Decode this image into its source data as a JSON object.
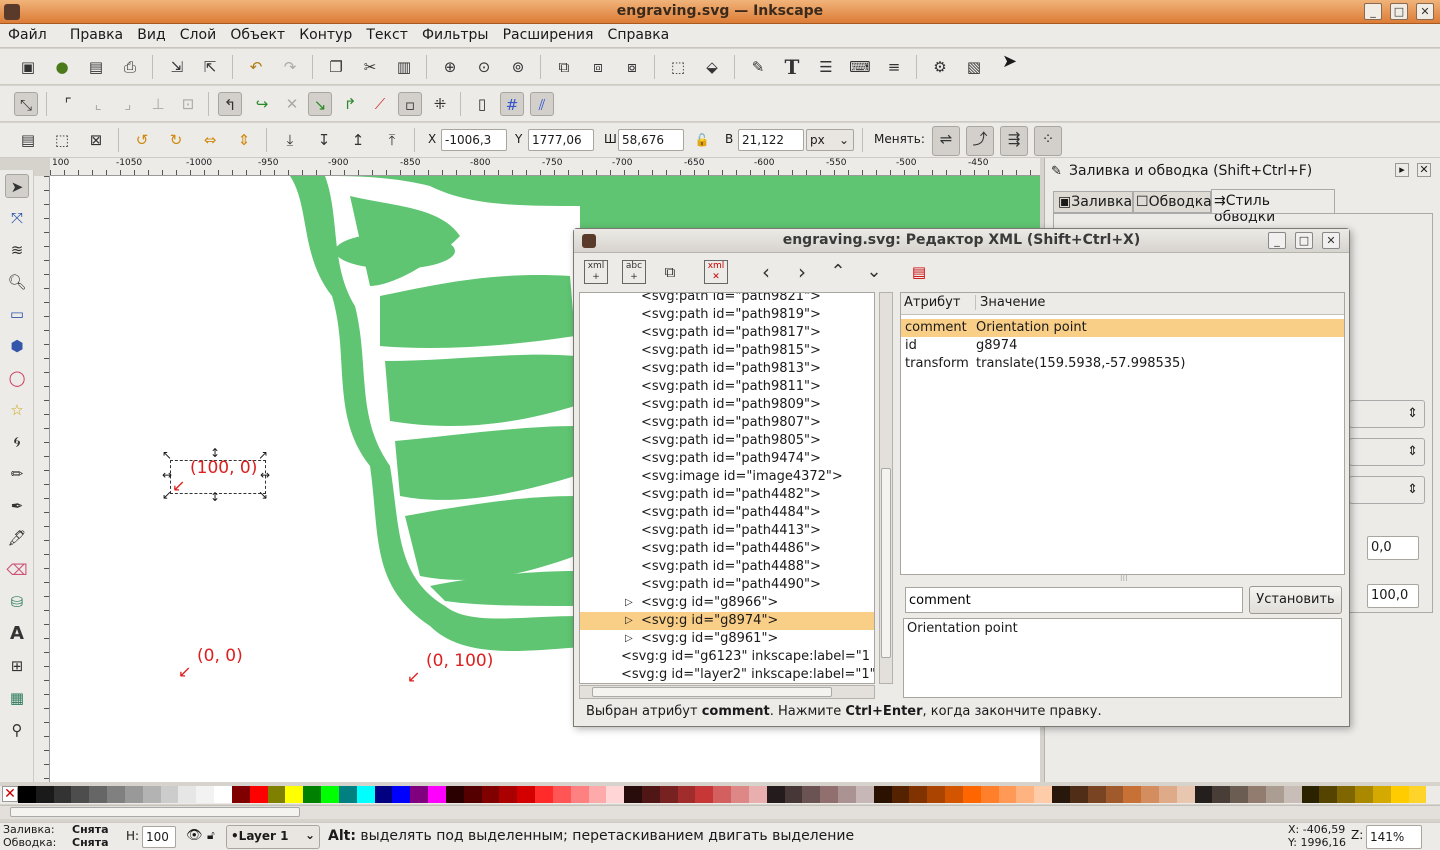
{
  "window": {
    "title": "engraving.svg — Inkscape"
  },
  "menu": [
    "Файл",
    "Правка",
    "Вид",
    "Слой",
    "Объект",
    "Контур",
    "Текст",
    "Фильтры",
    "Расширения",
    "Справка"
  ],
  "toolctrl": {
    "x_label": "X",
    "x": "-1006,3⁠",
    "y_label": "Y",
    "y": "1777,06",
    "w_label": "Ш",
    "w": "58,676",
    "h_label": "В",
    "h": "21,122",
    "unit": "px",
    "change_label": "Менять:"
  },
  "hruler": [
    "100",
    "-1050",
    "-1000",
    "-950",
    "-900",
    "-850",
    "-800",
    "-750",
    "-700",
    "-650",
    "-600",
    "-550",
    "-500",
    "-450"
  ],
  "canvas": {
    "sel_label": "(100, 0)",
    "label_00": "(0, 0)",
    "label_0100": "(0, 100)"
  },
  "panel": {
    "title": "Заливка и обводка (Shift+Ctrl+F)",
    "tabs": [
      "Заливка",
      "Обводка",
      "Стиль обводки"
    ],
    "v1": "0,0",
    "v2": "100,0"
  },
  "xml": {
    "title": "engraving.svg: Редактор XML (Shift+Ctrl+X)",
    "nodes": [
      "<svg:path id=\"path9821\">",
      "<svg:path id=\"path9819\">",
      "<svg:path id=\"path9817\">",
      "<svg:path id=\"path9815\">",
      "<svg:path id=\"path9813\">",
      "<svg:path id=\"path9811\">",
      "<svg:path id=\"path9809\">",
      "<svg:path id=\"path9807\">",
      "<svg:path id=\"path9805\">",
      "<svg:path id=\"path9474\">",
      "<svg:image id=\"image4372\">",
      "<svg:path id=\"path4482\">",
      "<svg:path id=\"path4484\">",
      "<svg:path id=\"path4413\">",
      "<svg:path id=\"path4486\">",
      "<svg:path id=\"path4488\">",
      "<svg:path id=\"path4490\">",
      "<svg:g id=\"g8966\">",
      "<svg:g id=\"g8974\">",
      "<svg:g id=\"g8961\">",
      "<svg:g id=\"g6123\" inkscape:label=\"1 c",
      "<svg:g id=\"layer2\" inkscape:label=\"1\""
    ],
    "attr_header": "Атрибут",
    "value_header": "Значение",
    "attrs": [
      {
        "name": "comment",
        "value": "Orientation point"
      },
      {
        "name": "id",
        "value": "g8974"
      },
      {
        "name": "transform",
        "value": "translate(159.5938,-57.998535)"
      }
    ],
    "name_input": "comment",
    "set_button": "Установить",
    "value_text": "Orientation point",
    "status_a": "Выбран атрибут ",
    "status_b": "comment",
    "status_c": ". Нажмите ",
    "status_d": "Ctrl+Enter",
    "status_e": ", когда закончите правку."
  },
  "palette": [
    "#000000",
    "#1a1a1a",
    "#333333",
    "#4d4d4d",
    "#666666",
    "#808080",
    "#999999",
    "#b3b3b3",
    "#cccccc",
    "#e6e6e6",
    "#f2f2f2",
    "#ffffff",
    "#800000",
    "#ff0000",
    "#808000",
    "#ffff00",
    "#008000",
    "#00ff00",
    "#008080",
    "#00ffff",
    "#000080",
    "#0000ff",
    "#800080",
    "#ff00ff",
    "#2b0000",
    "#550000",
    "#800000",
    "#aa0000",
    "#d40000",
    "#ff2a2a",
    "#ff5555",
    "#ff8080",
    "#ffaaaa",
    "#ffd5d5",
    "#280b0b",
    "#501616",
    "#782121",
    "#a02c2c",
    "#c83737",
    "#d35f5f",
    "#de8787",
    "#e9afaf",
    "#241c1c",
    "#483737",
    "#6c5353",
    "#916f6f",
    "#ac9393",
    "#c8b7b7",
    "#2b1100",
    "#552200",
    "#803300",
    "#aa4400",
    "#d45500",
    "#ff6600",
    "#ff7f2a",
    "#ff9955",
    "#ffb380",
    "#ffccaa",
    "#28170b",
    "#502d16",
    "#784421",
    "#a05a2c",
    "#c87137",
    "#d38d5f",
    "#deaa87",
    "#e9c6af",
    "#241f1c",
    "#483e37",
    "#6c5d53",
    "#917c6f",
    "#ac9d93",
    "#c8beb7",
    "#2b2200",
    "#554400",
    "#806600",
    "#aa8800",
    "#d4aa00",
    "#ffcc00",
    "#ffd42a"
  ],
  "status": {
    "fill_label": "Заливка:",
    "fill_val": "Снята",
    "stroke_label": "Обводка:",
    "stroke_val": "Снята",
    "h_label": "Н:",
    "h_val": "100",
    "layer": "•Layer 1",
    "msg_b": "Alt:",
    "msg": " выделять под выделенным; перетаскиванием двигать выделение",
    "x": "X: -406,59",
    "y": "Y: 1996,16",
    "z_label": "Z:",
    "zoom": "141%"
  }
}
